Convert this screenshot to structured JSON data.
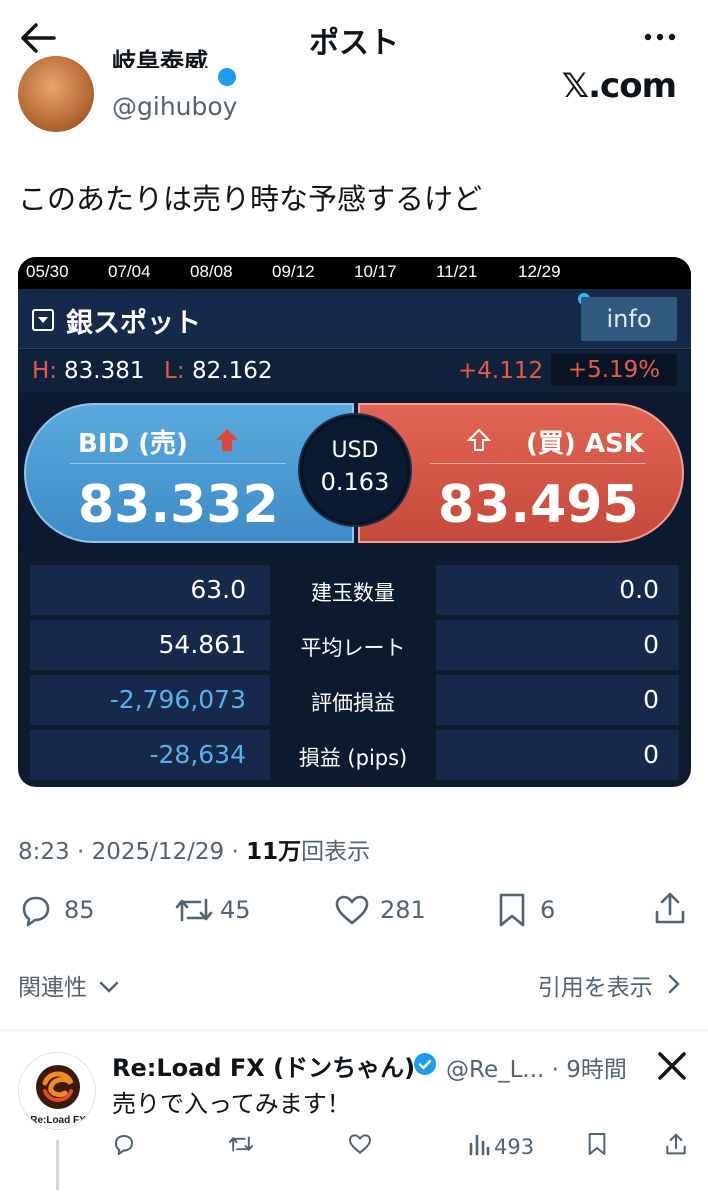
{
  "header": {
    "title": "ポスト",
    "back_icon": "arrow-left-icon",
    "more_icon": "more-icon"
  },
  "author": {
    "name": "岐阜泰威",
    "handle": "@gihuboy",
    "watermark": "𝕏.com"
  },
  "tweet": {
    "text": "このあたりは売り時な予感するけど"
  },
  "panel": {
    "dates": [
      "05/30",
      "07/04",
      "08/08",
      "09/12",
      "10/17",
      "11/21",
      "12/29"
    ],
    "symbol": "銀スポット",
    "info": "info",
    "high_label": "H:",
    "high": "83.381",
    "low_label": "L:",
    "low": "82.162",
    "change": "+4.112",
    "change_pct": "+5.19%",
    "bid_label": "BID (売)",
    "bid_price": "83.332",
    "ask_label": "(買) ASK",
    "ask_price": "83.495",
    "spread_ccy": "USD",
    "spread": "0.163",
    "stats": [
      {
        "left": "63.0",
        "label": "建玉数量",
        "right": "0.0",
        "neg": false
      },
      {
        "left": "54.861",
        "label": "平均レート",
        "right": "0",
        "neg": false
      },
      {
        "left": "-2,796,073",
        "label": "評価損益",
        "right": "0",
        "neg": true
      },
      {
        "left": "-28,634",
        "label": "損益 (pips)",
        "right": "0",
        "neg": true
      }
    ],
    "colors": {
      "bid": "#4a9ad4",
      "ask": "#d35545",
      "bg": "#0e1b2e"
    }
  },
  "meta": {
    "time": "8:23 · 2025/12/29 · ",
    "views_bold": "11万",
    "views_suffix": "回表示"
  },
  "actions": {
    "replies": "85",
    "reposts": "45",
    "likes": "281",
    "bookmarks": "6"
  },
  "footer": {
    "related": "関連性",
    "quotes": "引用を表示"
  },
  "reply": {
    "name": "Re:Load FX (ドンちゃん)",
    "handle": "@Re_L... · 9時間",
    "text": "売りで入ってみます！",
    "views": "493",
    "avatar_text": "Re:Load FX"
  }
}
